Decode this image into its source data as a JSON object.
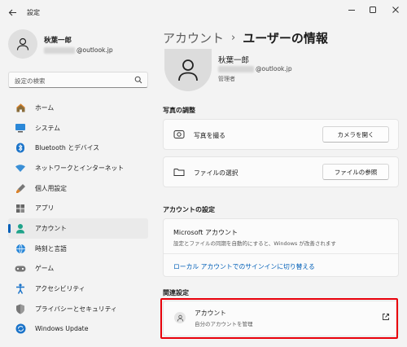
{
  "window": {
    "title": "設定"
  },
  "profile": {
    "name": "秋葉一郎",
    "email_domain": "@outlook.jp"
  },
  "search": {
    "placeholder": "設定の検索"
  },
  "sidebar": {
    "items": [
      {
        "label": "ホーム",
        "icon": "home-icon",
        "active": false
      },
      {
        "label": "システム",
        "icon": "system-icon",
        "active": false
      },
      {
        "label": "Bluetooth とデバイス",
        "icon": "bluetooth-icon",
        "active": false
      },
      {
        "label": "ネットワークとインターネット",
        "icon": "wifi-icon",
        "active": false
      },
      {
        "label": "個人用設定",
        "icon": "brush-icon",
        "active": false
      },
      {
        "label": "アプリ",
        "icon": "apps-icon",
        "active": false
      },
      {
        "label": "アカウント",
        "icon": "account-icon",
        "active": true
      },
      {
        "label": "時刻と言語",
        "icon": "globe-clock-icon",
        "active": false
      },
      {
        "label": "ゲーム",
        "icon": "gamepad-icon",
        "active": false
      },
      {
        "label": "アクセシビリティ",
        "icon": "accessibility-icon",
        "active": false
      },
      {
        "label": "プライバシーとセキュリティ",
        "icon": "shield-icon",
        "active": false
      },
      {
        "label": "Windows Update",
        "icon": "update-icon",
        "active": false
      }
    ]
  },
  "main": {
    "breadcrumb_parent": "アカウント",
    "breadcrumb_separator": "›",
    "breadcrumb_current": "ユーザーの情報",
    "user": {
      "name": "秋葉一郎",
      "email_domain": "@outlook.jp",
      "role": "管理者"
    },
    "photo_section": {
      "title": "写真の調整",
      "rows": [
        {
          "label": "写真を撮る",
          "button": "カメラを開く",
          "icon": "camera-icon"
        },
        {
          "label": "ファイルの選択",
          "button": "ファイルの参照",
          "icon": "folder-icon"
        }
      ]
    },
    "account_section": {
      "title": "アカウントの設定",
      "ms_title": "Microsoft アカウント",
      "ms_desc": "設定とファイルの同期を自動的にすると、Windows が改善されます",
      "link": "ローカル アカウントでのサインインに切り替える"
    },
    "related_section": {
      "title": "関連設定",
      "item_label": "アカウント",
      "item_desc": "自分のアカウントを管理",
      "highlight_color": "#e8000b"
    }
  },
  "colors": {
    "accent": "#005fb8",
    "background": "#f3f3f3",
    "card": "#fbfbfb"
  }
}
